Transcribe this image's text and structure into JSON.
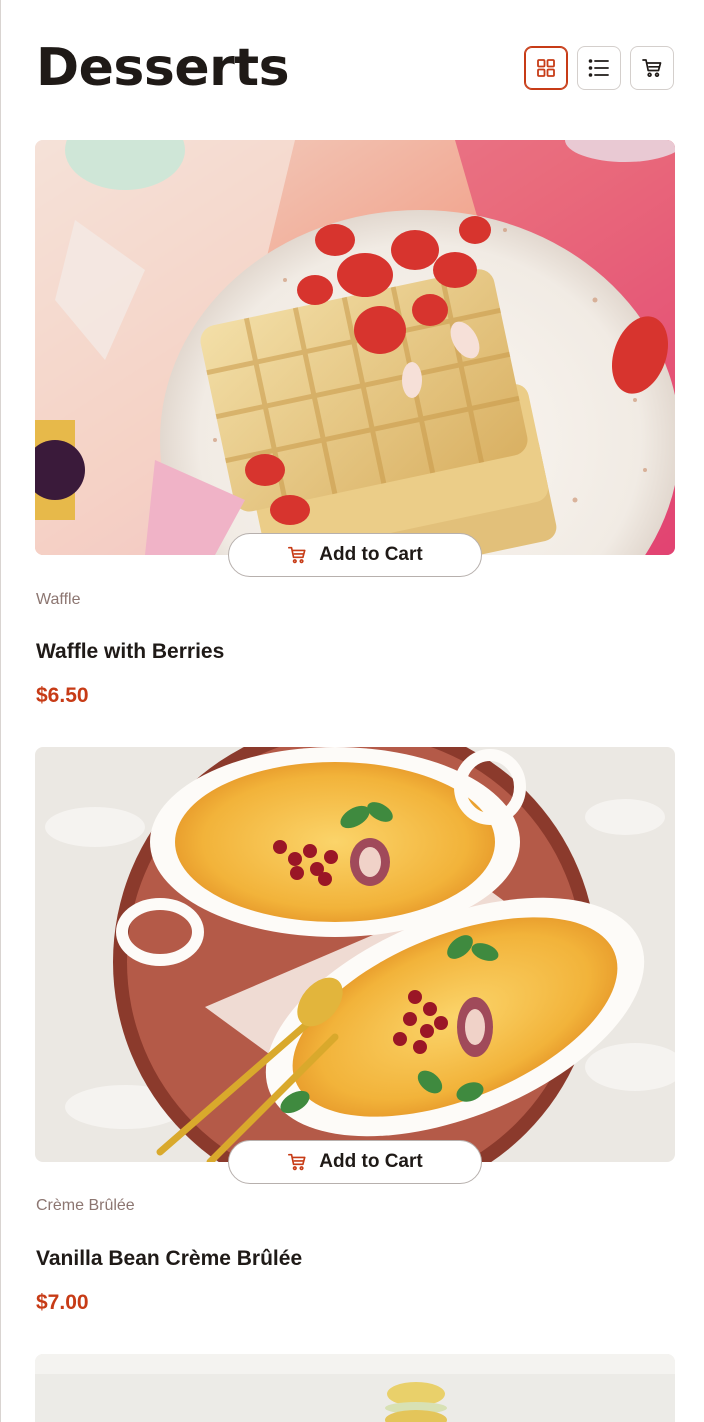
{
  "header": {
    "title": "Desserts",
    "buttons": [
      {
        "name": "grid-view",
        "icon": "grid-icon",
        "active": true
      },
      {
        "name": "list-view",
        "icon": "list-icon",
        "active": false
      },
      {
        "name": "cart",
        "icon": "cart-icon",
        "active": false
      }
    ]
  },
  "theme": {
    "accent": "#c73b16",
    "text": "#1f1a17",
    "muted": "#8c7671",
    "border": "#d4cfcc"
  },
  "products": [
    {
      "image": "waffle-with-berries-photo",
      "add_label": "Add to Cart",
      "category": "Waffle",
      "name": "Waffle with Berries",
      "price": "$6.50"
    },
    {
      "image": "creme-brulee-photo",
      "add_label": "Add to Cart",
      "category": "Crème Brûlée",
      "name": "Vanilla Bean Crème Brûlée",
      "price": "$7.00"
    },
    {
      "image": "macaron-photo"
    }
  ]
}
